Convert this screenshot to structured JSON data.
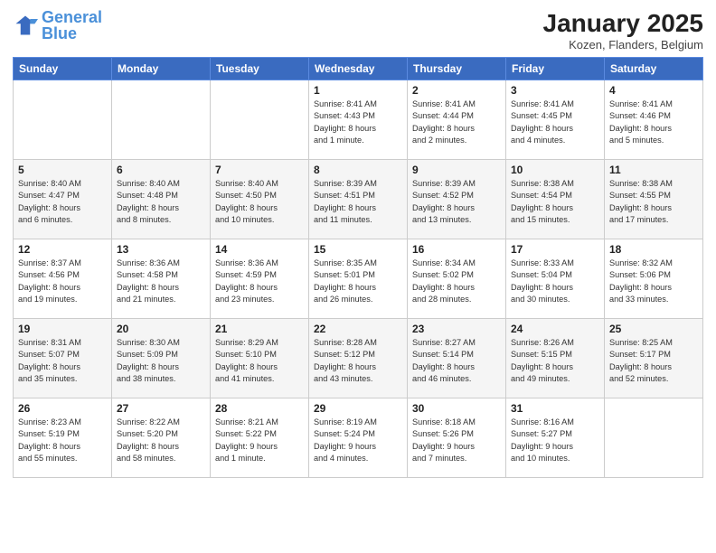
{
  "logo": {
    "text_general": "General",
    "text_blue": "Blue"
  },
  "title": {
    "month_year": "January 2025",
    "location": "Kozen, Flanders, Belgium"
  },
  "headers": [
    "Sunday",
    "Monday",
    "Tuesday",
    "Wednesday",
    "Thursday",
    "Friday",
    "Saturday"
  ],
  "weeks": [
    [
      {
        "num": "",
        "info": ""
      },
      {
        "num": "",
        "info": ""
      },
      {
        "num": "",
        "info": ""
      },
      {
        "num": "1",
        "info": "Sunrise: 8:41 AM\nSunset: 4:43 PM\nDaylight: 8 hours\nand 1 minute."
      },
      {
        "num": "2",
        "info": "Sunrise: 8:41 AM\nSunset: 4:44 PM\nDaylight: 8 hours\nand 2 minutes."
      },
      {
        "num": "3",
        "info": "Sunrise: 8:41 AM\nSunset: 4:45 PM\nDaylight: 8 hours\nand 4 minutes."
      },
      {
        "num": "4",
        "info": "Sunrise: 8:41 AM\nSunset: 4:46 PM\nDaylight: 8 hours\nand 5 minutes."
      }
    ],
    [
      {
        "num": "5",
        "info": "Sunrise: 8:40 AM\nSunset: 4:47 PM\nDaylight: 8 hours\nand 6 minutes."
      },
      {
        "num": "6",
        "info": "Sunrise: 8:40 AM\nSunset: 4:48 PM\nDaylight: 8 hours\nand 8 minutes."
      },
      {
        "num": "7",
        "info": "Sunrise: 8:40 AM\nSunset: 4:50 PM\nDaylight: 8 hours\nand 10 minutes."
      },
      {
        "num": "8",
        "info": "Sunrise: 8:39 AM\nSunset: 4:51 PM\nDaylight: 8 hours\nand 11 minutes."
      },
      {
        "num": "9",
        "info": "Sunrise: 8:39 AM\nSunset: 4:52 PM\nDaylight: 8 hours\nand 13 minutes."
      },
      {
        "num": "10",
        "info": "Sunrise: 8:38 AM\nSunset: 4:54 PM\nDaylight: 8 hours\nand 15 minutes."
      },
      {
        "num": "11",
        "info": "Sunrise: 8:38 AM\nSunset: 4:55 PM\nDaylight: 8 hours\nand 17 minutes."
      }
    ],
    [
      {
        "num": "12",
        "info": "Sunrise: 8:37 AM\nSunset: 4:56 PM\nDaylight: 8 hours\nand 19 minutes."
      },
      {
        "num": "13",
        "info": "Sunrise: 8:36 AM\nSunset: 4:58 PM\nDaylight: 8 hours\nand 21 minutes."
      },
      {
        "num": "14",
        "info": "Sunrise: 8:36 AM\nSunset: 4:59 PM\nDaylight: 8 hours\nand 23 minutes."
      },
      {
        "num": "15",
        "info": "Sunrise: 8:35 AM\nSunset: 5:01 PM\nDaylight: 8 hours\nand 26 minutes."
      },
      {
        "num": "16",
        "info": "Sunrise: 8:34 AM\nSunset: 5:02 PM\nDaylight: 8 hours\nand 28 minutes."
      },
      {
        "num": "17",
        "info": "Sunrise: 8:33 AM\nSunset: 5:04 PM\nDaylight: 8 hours\nand 30 minutes."
      },
      {
        "num": "18",
        "info": "Sunrise: 8:32 AM\nSunset: 5:06 PM\nDaylight: 8 hours\nand 33 minutes."
      }
    ],
    [
      {
        "num": "19",
        "info": "Sunrise: 8:31 AM\nSunset: 5:07 PM\nDaylight: 8 hours\nand 35 minutes."
      },
      {
        "num": "20",
        "info": "Sunrise: 8:30 AM\nSunset: 5:09 PM\nDaylight: 8 hours\nand 38 minutes."
      },
      {
        "num": "21",
        "info": "Sunrise: 8:29 AM\nSunset: 5:10 PM\nDaylight: 8 hours\nand 41 minutes."
      },
      {
        "num": "22",
        "info": "Sunrise: 8:28 AM\nSunset: 5:12 PM\nDaylight: 8 hours\nand 43 minutes."
      },
      {
        "num": "23",
        "info": "Sunrise: 8:27 AM\nSunset: 5:14 PM\nDaylight: 8 hours\nand 46 minutes."
      },
      {
        "num": "24",
        "info": "Sunrise: 8:26 AM\nSunset: 5:15 PM\nDaylight: 8 hours\nand 49 minutes."
      },
      {
        "num": "25",
        "info": "Sunrise: 8:25 AM\nSunset: 5:17 PM\nDaylight: 8 hours\nand 52 minutes."
      }
    ],
    [
      {
        "num": "26",
        "info": "Sunrise: 8:23 AM\nSunset: 5:19 PM\nDaylight: 8 hours\nand 55 minutes."
      },
      {
        "num": "27",
        "info": "Sunrise: 8:22 AM\nSunset: 5:20 PM\nDaylight: 8 hours\nand 58 minutes."
      },
      {
        "num": "28",
        "info": "Sunrise: 8:21 AM\nSunset: 5:22 PM\nDaylight: 9 hours\nand 1 minute."
      },
      {
        "num": "29",
        "info": "Sunrise: 8:19 AM\nSunset: 5:24 PM\nDaylight: 9 hours\nand 4 minutes."
      },
      {
        "num": "30",
        "info": "Sunrise: 8:18 AM\nSunset: 5:26 PM\nDaylight: 9 hours\nand 7 minutes."
      },
      {
        "num": "31",
        "info": "Sunrise: 8:16 AM\nSunset: 5:27 PM\nDaylight: 9 hours\nand 10 minutes."
      },
      {
        "num": "",
        "info": ""
      }
    ]
  ]
}
